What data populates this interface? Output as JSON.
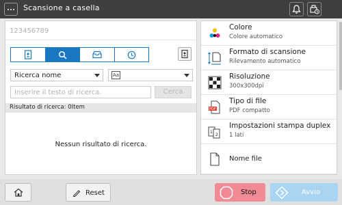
{
  "header": {
    "title": "Scansione a casella"
  },
  "left_panel": {
    "address_placeholder": "123456789",
    "tabs": [
      {
        "name": "tab-address-book",
        "icon": "address-book-icon",
        "active": false
      },
      {
        "name": "tab-search",
        "icon": "search-icon",
        "active": true
      },
      {
        "name": "tab-box",
        "icon": "box-tray-icon",
        "active": false
      },
      {
        "name": "tab-history",
        "icon": "clock-icon",
        "active": false
      }
    ],
    "search_type": "Ricerca nome",
    "search_placeholder": "Inserire il testo di ricerca.",
    "search_button": "Cerca",
    "result_label": "Risultato di ricerca: 0Item",
    "no_result_text": "Nessun risultato di ricerca."
  },
  "settings": [
    {
      "title": "Colore",
      "value": "Colore automatico",
      "icon": "color-dots-icon"
    },
    {
      "title": "Formato di scansione",
      "value": "Rilevamento automatico",
      "icon": "scan-size-icon"
    },
    {
      "title": "Risoluzione",
      "value": "300x300dpi",
      "icon": "resolution-icon"
    },
    {
      "title": "Tipo di file",
      "value": "PDF compatto",
      "icon": "pdf-file-icon"
    },
    {
      "title": "Impostazioni stampa duplex",
      "value": "1 lati",
      "icon": "duplex-icon"
    },
    {
      "title": "Nome file",
      "value": "",
      "icon": "document-icon"
    }
  ],
  "footer": {
    "reset_label": "Reset",
    "stop_label": "Stop",
    "start_label": "Avvio"
  },
  "colors": {
    "accent": "#1a78c2",
    "stop": "#f08b95",
    "start": "#a9d5f2",
    "topbar": "#3f3f3f"
  }
}
